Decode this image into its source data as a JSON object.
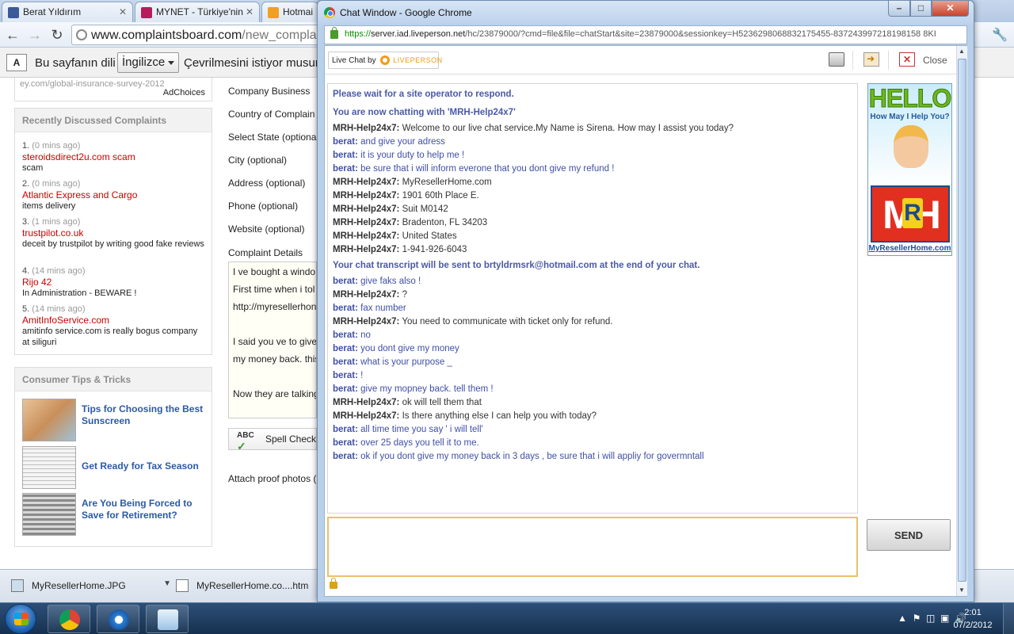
{
  "bg_browser": {
    "tabs": [
      {
        "label": "Berat Yıldırım",
        "color": "#3b5998"
      },
      {
        "label": "MYNET - Türkiye'nin",
        "color": "#b71b5c"
      },
      {
        "label": "Hotmai",
        "color": "#f0a020"
      }
    ],
    "url_host": "www.complaintsboard.com",
    "url_path": "/new_complain",
    "translate": {
      "text_before": "Bu sayfanın dili",
      "language": "İngilizce",
      "text_after": "Çevrilmesini istiyor musun"
    },
    "ad": {
      "url": "ey.com/global-insurance-survey-2012",
      "choices": "AdChoices"
    },
    "recent": {
      "heading": "Recently Discussed Complaints",
      "items": [
        {
          "num": "1.",
          "time": "(0 mins ago)",
          "title": "steroidsdirect2u.com scam",
          "desc": "scam"
        },
        {
          "num": "2.",
          "time": "(0 mins ago)",
          "title": "Atlantic Express and Cargo",
          "desc": "items delivery"
        },
        {
          "num": "3.",
          "time": "(1 mins ago)",
          "title": "trustpilot.co.uk",
          "desc": "deceit by trustpilot by writing good fake reviews"
        },
        {
          "num": "4.",
          "time": "(14 mins ago)",
          "title": "Rijo 42",
          "desc": "In Administration - BEWARE !"
        },
        {
          "num": "5.",
          "time": "(14 mins ago)",
          "title": "AmitInfoService.com",
          "desc": "amitinfo service.com is really bogus company at siliguri"
        }
      ]
    },
    "tips": {
      "heading": "Consumer Tips & Tricks",
      "items": [
        {
          "label": "Tips for Choosing the Best Sunscreen"
        },
        {
          "label": "Get Ready for Tax Season"
        },
        {
          "label": "Are You Being Forced to Save for Retirement?"
        }
      ]
    },
    "form": {
      "labels": [
        "Company Business",
        "Country of Complain",
        "Select State (optiona",
        "City (optional)",
        "Address (optional)",
        "Phone (optional)",
        "Website (optional)",
        "Complaint Details"
      ],
      "details_lines": [
        "I ve bought a windo",
        "First time when i tol",
        "http://myresellerhon",
        "I said you ve to give",
        "my money back. this",
        "Now they are talking"
      ],
      "spell_check": "Spell Check",
      "attach": "Attach proof photos ("
    },
    "downloads": [
      {
        "label": "MyResellerHome.JPG"
      },
      {
        "label": "MyResellerHome.co....htm"
      }
    ]
  },
  "chat_window": {
    "title": "Chat Window - Google Chrome",
    "url_secure": "https://",
    "url_host": "server.iad.liveperson.net",
    "url_rest": "/hc/23879000/?cmd=file&file=chatStart&site=23879000&sessionkey=H5236298068832175455-837243997218198158 8KI",
    "live_chat_by": "Live Chat by",
    "liveperson": "LIVEPERSON",
    "close_label": "Close",
    "send_label": "SEND",
    "ad": {
      "hello": "HELLO",
      "help": "How May I Help You?",
      "letters": "MH",
      "r": "R",
      "url": "MyResellerHome.com"
    },
    "messages": [
      {
        "type": "system",
        "text": "Please wait for a site operator to respond."
      },
      {
        "type": "system",
        "text": "You are now chatting with 'MRH-Help24x7'"
      },
      {
        "type": "operator",
        "who": "MRH-Help24x7:",
        "text": "Welcome to our live chat service.My Name is Sirena. How may I assist you today?"
      },
      {
        "type": "visitor",
        "who": "berat:",
        "text": "and give your adress"
      },
      {
        "type": "visitor",
        "who": "berat:",
        "text": "it is your duty to help me !"
      },
      {
        "type": "visitor",
        "who": "berat:",
        "text": "be sure that i will inform everone that you dont give my refund !"
      },
      {
        "type": "operator",
        "who": "MRH-Help24x7:",
        "text": "MyResellerHome.com"
      },
      {
        "type": "operator",
        "who": "MRH-Help24x7:",
        "text": "1901 60th Place E."
      },
      {
        "type": "operator",
        "who": "MRH-Help24x7:",
        "text": "Suit M0142"
      },
      {
        "type": "operator",
        "who": "MRH-Help24x7:",
        "text": "Bradenton, FL 34203"
      },
      {
        "type": "operator",
        "who": "MRH-Help24x7:",
        "text": "United States"
      },
      {
        "type": "operator",
        "who": "MRH-Help24x7:",
        "text": "1-941-926-6043"
      },
      {
        "type": "system",
        "text": "Your chat transcript will be sent to brtyldrmsrk@hotmail.com at the end of your chat."
      },
      {
        "type": "visitor",
        "who": "berat:",
        "text": "give faks also !"
      },
      {
        "type": "operator",
        "who": "MRH-Help24x7:",
        "text": "?"
      },
      {
        "type": "visitor",
        "who": "berat:",
        "text": "fax number"
      },
      {
        "type": "operator",
        "who": "MRH-Help24x7:",
        "text": "You need to communicate with ticket only for refund."
      },
      {
        "type": "visitor",
        "who": "berat:",
        "text": "no"
      },
      {
        "type": "visitor",
        "who": "berat:",
        "text": "you dont give my money"
      },
      {
        "type": "visitor",
        "who": "berat:",
        "text": "what is your purpose _"
      },
      {
        "type": "visitor",
        "who": "berat:",
        "text": "!"
      },
      {
        "type": "visitor",
        "who": "berat:",
        "text": "give my mopney back. tell them !"
      },
      {
        "type": "operator",
        "who": "MRH-Help24x7:",
        "text": "ok will tell them that"
      },
      {
        "type": "operator",
        "who": "MRH-Help24x7:",
        "text": "Is there anything else I can help you with today?"
      },
      {
        "type": "visitor",
        "who": "berat:",
        "text": "all time time you say ' i will tell'"
      },
      {
        "type": "visitor",
        "who": "berat:",
        "text": "over 25 days you tell it to me."
      },
      {
        "type": "visitor",
        "who": "berat:",
        "text": "ok if you dont give my money back in 3 days , be sure that i will appliy for govermntall"
      }
    ]
  },
  "taskbar": {
    "time": "2:01",
    "date": "07/2/2012"
  }
}
